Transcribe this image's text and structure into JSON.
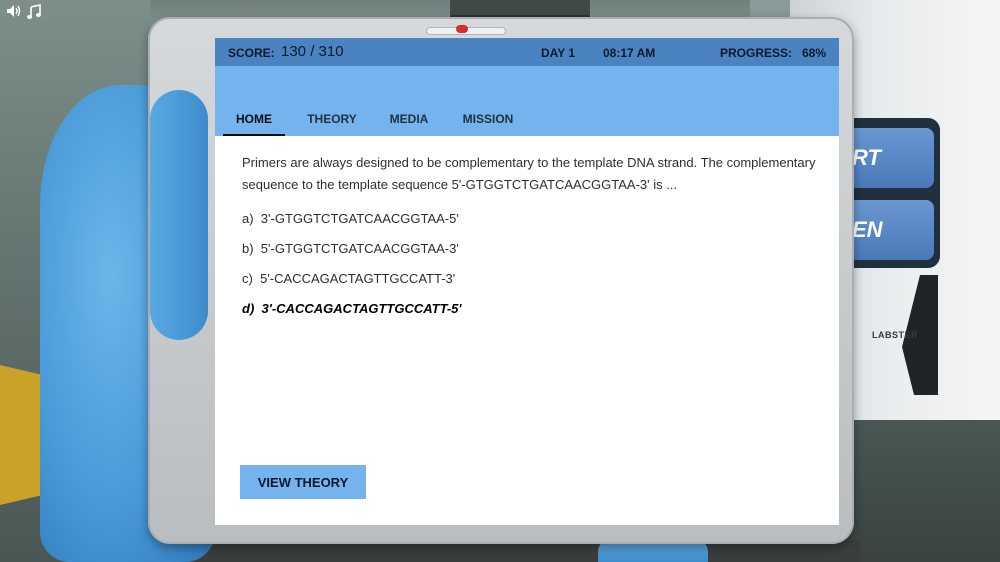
{
  "hud": {
    "sound_icon": "speaker-icon",
    "music_icon": "music-note-icon"
  },
  "machine": {
    "button_one_text": "RT",
    "button_two_text": "EN",
    "brand": "LABSTER"
  },
  "status": {
    "score_label": "SCORE:",
    "score_value": "130 / 310",
    "day": "DAY 1",
    "time": "08:17 AM",
    "progress_label": "PROGRESS:",
    "progress_value": "68%"
  },
  "tabs": [
    {
      "label": "HOME",
      "active": true
    },
    {
      "label": "THEORY",
      "active": false
    },
    {
      "label": "MEDIA",
      "active": false
    },
    {
      "label": "MISSION",
      "active": false
    }
  ],
  "question": {
    "text": "Primers are always designed to be complementary to the template DNA strand. The complementary sequence to the template sequence 5'-GTGGTCTGATCAACGGTAA-3' is ...",
    "options": [
      {
        "letter": "a)",
        "text": "3'-GTGGTCTGATCAACGGTAA-5'",
        "selected": false
      },
      {
        "letter": "b)",
        "text": "5'-GTGGTCTGATCAACGGTAA-3'",
        "selected": false
      },
      {
        "letter": "c)",
        "text": "5'-CACCAGACTAGTTGCCATT-3'",
        "selected": false
      },
      {
        "letter": "d)",
        "text": "3'-CACCAGACTAGTTGCCATT-5'",
        "selected": true
      }
    ]
  },
  "actions": {
    "view_theory_label": "VIEW THEORY"
  },
  "colors": {
    "status_bar": "#4a82c2",
    "nav_area": "#74b3ee",
    "button": "#74b3ee"
  }
}
